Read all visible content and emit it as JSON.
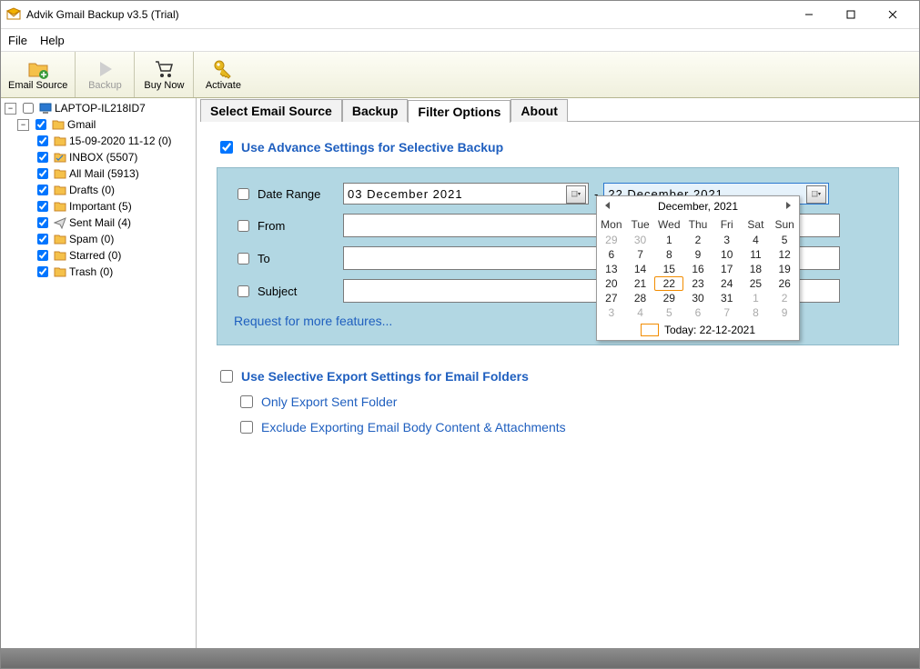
{
  "window": {
    "title": "Advik Gmail Backup v3.5 (Trial)"
  },
  "menubar": [
    "File",
    "Help"
  ],
  "toolbar": {
    "emailSource": "Email Source",
    "backup": "Backup",
    "buyNow": "Buy Now",
    "activate": "Activate"
  },
  "tree": {
    "root": "LAPTOP-IL218ID7",
    "account": "Gmail",
    "folders": [
      "15-09-2020 11-12 (0)",
      "INBOX (5507)",
      "All Mail (5913)",
      "Drafts (0)",
      "Important (5)",
      "Sent Mail (4)",
      "Spam (0)",
      "Starred (0)",
      "Trash (0)"
    ]
  },
  "tabs": {
    "selectSource": "Select Email Source",
    "backup": "Backup",
    "filterOptions": "Filter Options",
    "about": "About"
  },
  "filter": {
    "advanceTitle": "Use Advance Settings for Selective Backup",
    "dateRangeLabel": "Date Range",
    "fromLabel": "From",
    "toLabel": "To",
    "subjectLabel": "Subject",
    "dateFrom": "03  December  2021",
    "dateTo": "22  December  2021",
    "requestLink": "Request for more features...",
    "selectiveTitle": "Use Selective Export Settings for Email Folders",
    "onlySent": "Only Export Sent Folder",
    "excludeBody": "Exclude Exporting Email Body Content & Attachments"
  },
  "calendar": {
    "header": "December, 2021",
    "dow": [
      "Mon",
      "Tue",
      "Wed",
      "Thu",
      "Fri",
      "Sat",
      "Sun"
    ],
    "weeks": [
      [
        {
          "d": "29",
          "g": true
        },
        {
          "d": "30",
          "g": true
        },
        {
          "d": "1"
        },
        {
          "d": "2"
        },
        {
          "d": "3"
        },
        {
          "d": "4"
        },
        {
          "d": "5"
        }
      ],
      [
        {
          "d": "6"
        },
        {
          "d": "7"
        },
        {
          "d": "8"
        },
        {
          "d": "9"
        },
        {
          "d": "10"
        },
        {
          "d": "11"
        },
        {
          "d": "12"
        }
      ],
      [
        {
          "d": "13"
        },
        {
          "d": "14"
        },
        {
          "d": "15"
        },
        {
          "d": "16"
        },
        {
          "d": "17"
        },
        {
          "d": "18"
        },
        {
          "d": "19"
        }
      ],
      [
        {
          "d": "20"
        },
        {
          "d": "21"
        },
        {
          "d": "22",
          "sel": true
        },
        {
          "d": "23"
        },
        {
          "d": "24"
        },
        {
          "d": "25"
        },
        {
          "d": "26"
        }
      ],
      [
        {
          "d": "27"
        },
        {
          "d": "28"
        },
        {
          "d": "29"
        },
        {
          "d": "30"
        },
        {
          "d": "31"
        },
        {
          "d": "1",
          "g": true
        },
        {
          "d": "2",
          "g": true
        }
      ],
      [
        {
          "d": "3",
          "g": true
        },
        {
          "d": "4",
          "g": true
        },
        {
          "d": "5",
          "g": true
        },
        {
          "d": "6",
          "g": true
        },
        {
          "d": "7",
          "g": true
        },
        {
          "d": "8",
          "g": true
        },
        {
          "d": "9",
          "g": true
        }
      ]
    ],
    "today": "Today: 22-12-2021"
  }
}
